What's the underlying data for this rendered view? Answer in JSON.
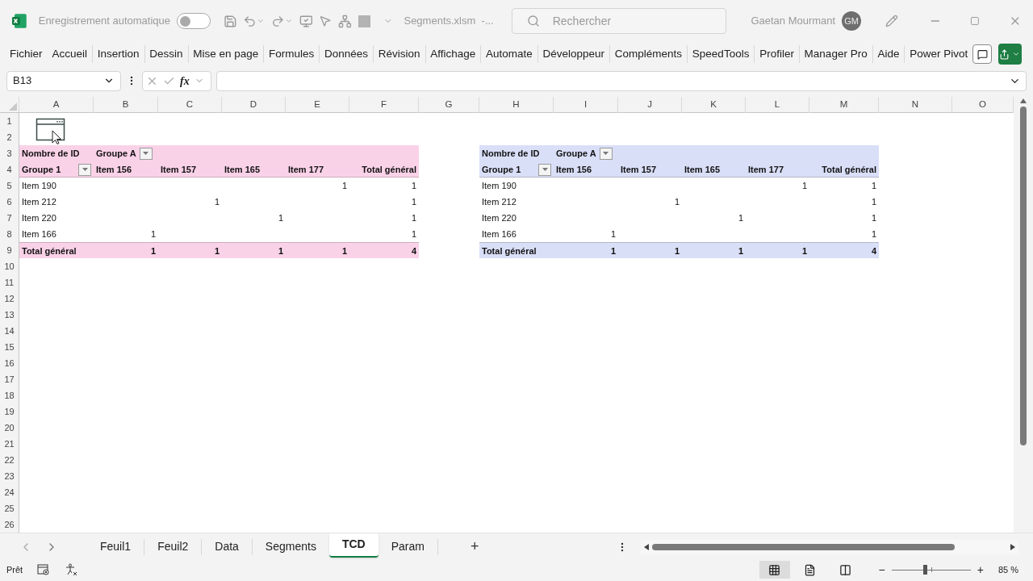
{
  "title_bar": {
    "autosave_label": "Enregistrement automatique",
    "autosave_on": false,
    "file_name": "Segments.xlsm  -...",
    "search_placeholder": "Rechercher",
    "user_name": "Gaetan Mourmant",
    "user_initials": "GM"
  },
  "ribbon_tabs": [
    "Fichier",
    "Accueil",
    "Insertion",
    "Dessin",
    "Mise en page",
    "Formules",
    "Données",
    "Révision",
    "Affichage",
    "Automate",
    "Développeur",
    "Compléments",
    "SpeedTools",
    "Profiler",
    "Manager Pro",
    "Aide",
    "Power Pivot"
  ],
  "formula_bar": {
    "name_box": "B13",
    "fx": "fx"
  },
  "columns": [
    "A",
    "B",
    "C",
    "D",
    "E",
    "F",
    "G",
    "H",
    "I",
    "J",
    "K",
    "L",
    "M",
    "N",
    "O"
  ],
  "rows": [
    "1",
    "2",
    "3",
    "4",
    "5",
    "6",
    "7",
    "8",
    "9",
    "10",
    "11",
    "12",
    "13",
    "14",
    "15",
    "16",
    "17",
    "18",
    "19",
    "20",
    "21",
    "22",
    "23",
    "24",
    "25",
    "26"
  ],
  "pivots": [
    {
      "color": "#fad2e8",
      "value_field": "Nombre de ID",
      "filter_field": "Groupe A",
      "row_field": "Groupe 1",
      "column_items": [
        "Item 156",
        "Item 157",
        "Item 165",
        "Item 177",
        "Total général"
      ],
      "rows": [
        {
          "label": "Item 190",
          "cells": [
            null,
            null,
            null,
            "1",
            "1"
          ]
        },
        {
          "label": "Item 212",
          "cells": [
            null,
            "1",
            null,
            null,
            "1"
          ]
        },
        {
          "label": "Item 220",
          "cells": [
            null,
            null,
            "1",
            null,
            "1"
          ]
        },
        {
          "label": "Item 166",
          "cells": [
            "1",
            null,
            null,
            null,
            "1"
          ]
        }
      ],
      "total": {
        "label": "Total général",
        "cells": [
          "1",
          "1",
          "1",
          "1",
          "4"
        ]
      }
    },
    {
      "color": "#dadff8",
      "value_field": "Nombre de ID",
      "filter_field": "Groupe A",
      "row_field": "Groupe 1",
      "column_items": [
        "Item 156",
        "Item 157",
        "Item 165",
        "Item 177",
        "Total général"
      ],
      "rows": [
        {
          "label": "Item 190",
          "cells": [
            null,
            null,
            null,
            "1",
            "1"
          ]
        },
        {
          "label": "Item 212",
          "cells": [
            null,
            "1",
            null,
            null,
            "1"
          ]
        },
        {
          "label": "Item 220",
          "cells": [
            null,
            null,
            "1",
            null,
            "1"
          ]
        },
        {
          "label": "Item 166",
          "cells": [
            "1",
            null,
            null,
            null,
            "1"
          ]
        }
      ],
      "total": {
        "label": "Total général",
        "cells": [
          "1",
          "1",
          "1",
          "1",
          "4"
        ]
      }
    }
  ],
  "sheet_tabs": [
    {
      "label": "Feuil1",
      "selected": false
    },
    {
      "label": "Feuil2",
      "selected": false
    },
    {
      "label": "Data",
      "selected": false
    },
    {
      "label": "Segments",
      "selected": false
    },
    {
      "label": "TCD",
      "selected": true
    },
    {
      "label": "Param",
      "selected": false
    }
  ],
  "add_sheet": "+",
  "status_bar": {
    "status": "Prêt",
    "views": [
      {
        "kind": "normal",
        "selected": true
      },
      {
        "kind": "page_layout",
        "selected": false
      },
      {
        "kind": "page_break",
        "selected": false
      }
    ],
    "zoom": {
      "level": 0.42,
      "reading": "85 %"
    },
    "zoom_out": "−",
    "zoom_in": "+"
  }
}
